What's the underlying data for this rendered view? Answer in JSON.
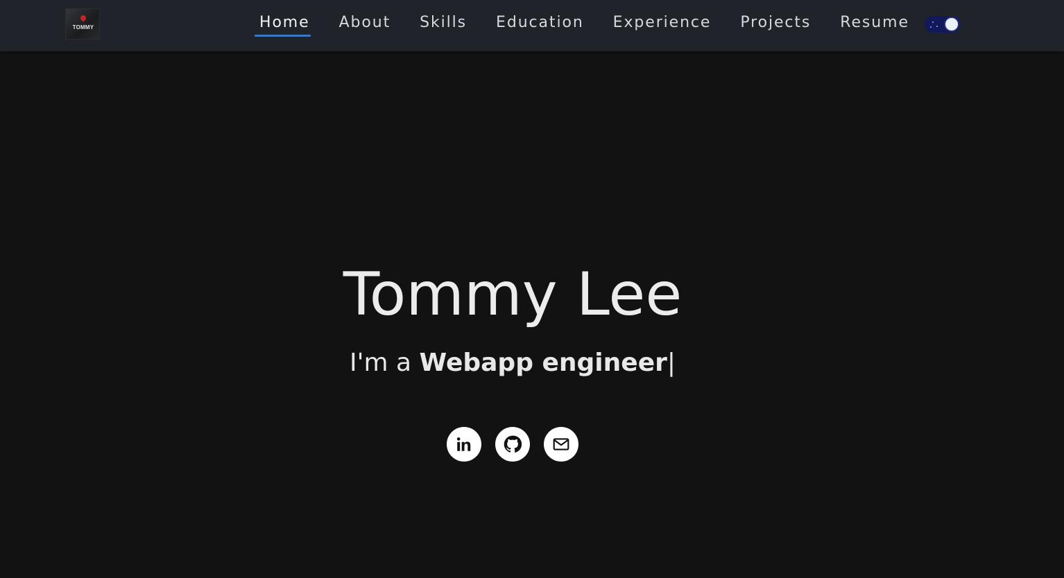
{
  "logo": {
    "text": "TOMMY"
  },
  "nav": {
    "items": [
      {
        "label": "Home",
        "active": true
      },
      {
        "label": "About",
        "active": false
      },
      {
        "label": "Skills",
        "active": false
      },
      {
        "label": "Education",
        "active": false
      },
      {
        "label": "Experience",
        "active": false
      },
      {
        "label": "Projects",
        "active": false
      },
      {
        "label": "Resume",
        "active": false
      }
    ],
    "theme_toggle": {
      "state": "dark"
    }
  },
  "hero": {
    "name": "Tommy Lee",
    "tagline_prefix": "I'm a ",
    "tagline_role": "Webapp engineer",
    "cursor": "|"
  },
  "socials": [
    {
      "icon": "linkedin-icon"
    },
    {
      "icon": "github-icon"
    },
    {
      "icon": "mail-icon"
    }
  ],
  "colors": {
    "background": "#121212",
    "navbar": "#202329",
    "active_underline": "#3a78c3",
    "toggle_track": "#12195a"
  }
}
